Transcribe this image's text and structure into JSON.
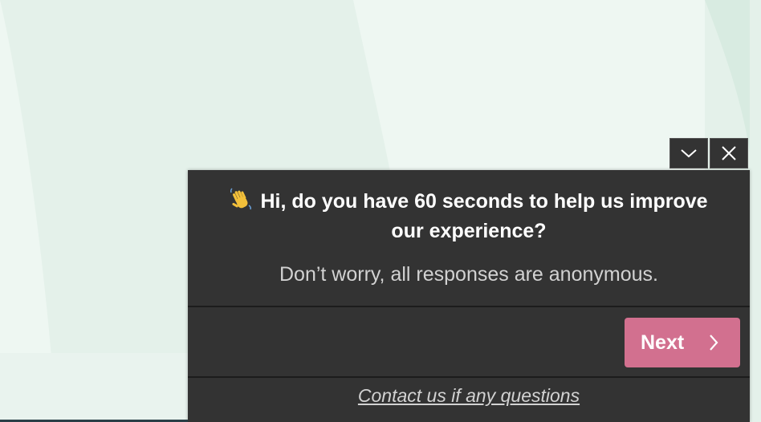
{
  "background": {
    "base_color": "#e4f1ea",
    "light_color": "#eef7f2"
  },
  "survey": {
    "controls": {
      "minimize_icon": "chevron-down-icon",
      "close_icon": "close-icon"
    },
    "wave_icon": "waving-hand-icon",
    "title": "Hi, do you have 60 seconds to help us improve our experience?",
    "subtitle": "Don’t worry, all responses are anonymous.",
    "next_label": "Next",
    "next_icon": "chevron-right-icon",
    "contact_link": "Contact us if any questions",
    "colors": {
      "panel": "#333333",
      "next_button": "#d2708f",
      "text": "#ffffff",
      "muted_text": "#d2d2d2"
    }
  }
}
